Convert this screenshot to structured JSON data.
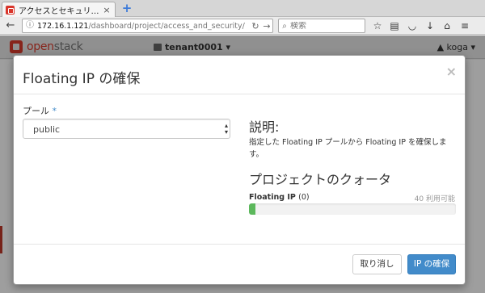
{
  "browser": {
    "tab_title": "アクセスとセキュリ…",
    "tab_close": "×",
    "new_tab": "+",
    "url_host": "172.16.1.121",
    "url_path": "/dashboard/project/access_and_security/",
    "search_placeholder": "検索"
  },
  "header": {
    "logo_text_a": "open",
    "logo_text_b": "stack",
    "tenant": "tenant0001 ▾",
    "user": "▲ koga ▾"
  },
  "modal": {
    "title": "Floating IP の確保",
    "close": "×",
    "pool_label": "プール",
    "pool_required": "*",
    "pool_value": "public",
    "help_title": "説明:",
    "help_text": "指定した Floating IP プールから Floating IP を確保します。",
    "quota_title": "プロジェクトのクォータ",
    "quota_label": "Floating IP",
    "quota_used": "(0)",
    "quota_available": "40 利用可能",
    "quota_used_fraction": 0.03,
    "cancel_label": "取り消し",
    "submit_label": "IP の確保"
  },
  "colors": {
    "brand": "#da3b2c",
    "primary": "#428bca",
    "progress": "#5cb85c"
  }
}
